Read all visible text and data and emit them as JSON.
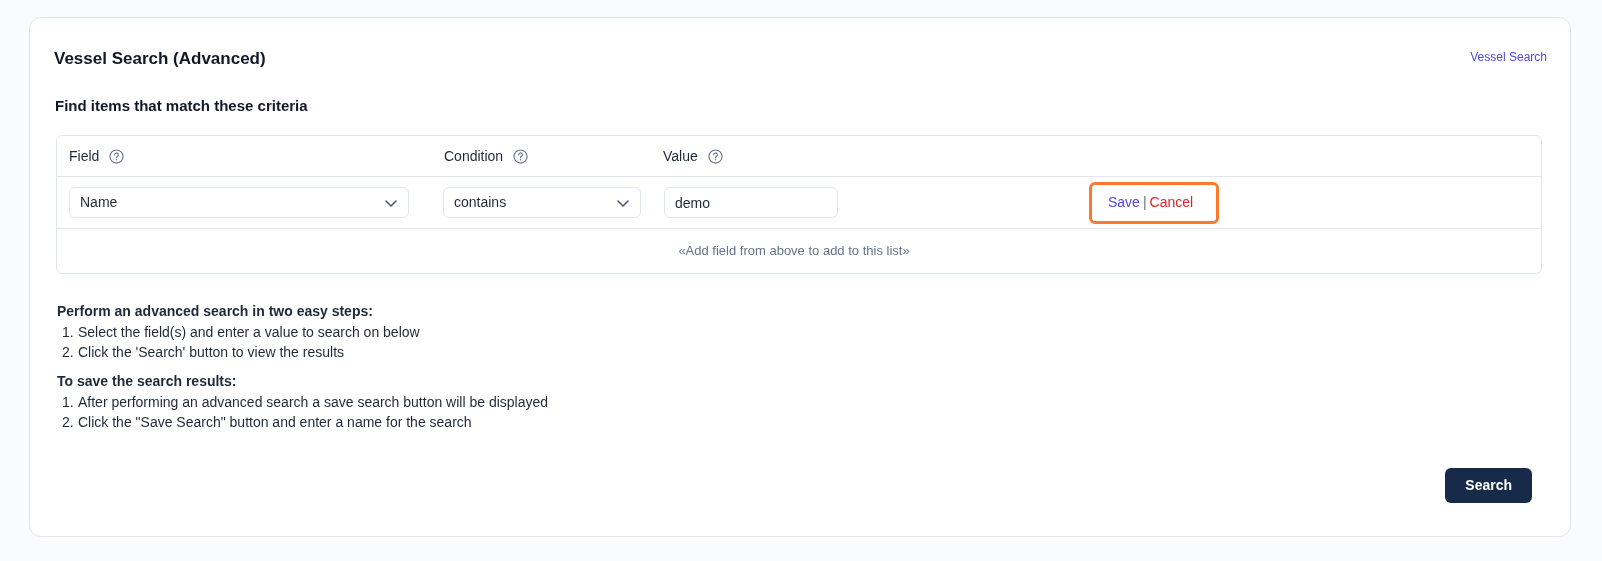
{
  "title": "Vessel Search (Advanced)",
  "top_link": "Vessel Search",
  "section_title": "Find items that match these criteria",
  "table": {
    "columns": [
      {
        "label": "Field"
      },
      {
        "label": "Condition"
      },
      {
        "label": "Value"
      }
    ],
    "row": {
      "field": "Name",
      "condition": "contains",
      "value": "demo",
      "save": "Save",
      "separator": "|",
      "cancel": "Cancel",
      "highlighted": true
    },
    "footer": "«Add field from above to add to this list»"
  },
  "instructions": [
    {
      "heading": "Perform an advanced search in two easy steps:",
      "steps": [
        {
          "number": "1.",
          "text": "Select the field(s) and enter a value to search on below"
        },
        {
          "number": "2.",
          "text": "Click the 'Search' button to view the results"
        }
      ]
    },
    {
      "heading": "To save the search results:",
      "steps": [
        {
          "number": "1.",
          "text": "After performing an advanced search a save search button will be displayed"
        },
        {
          "number": "2.",
          "text": "Click the \"Save Search\" button and enter a name for the search"
        }
      ]
    }
  ],
  "search_button": "Search"
}
